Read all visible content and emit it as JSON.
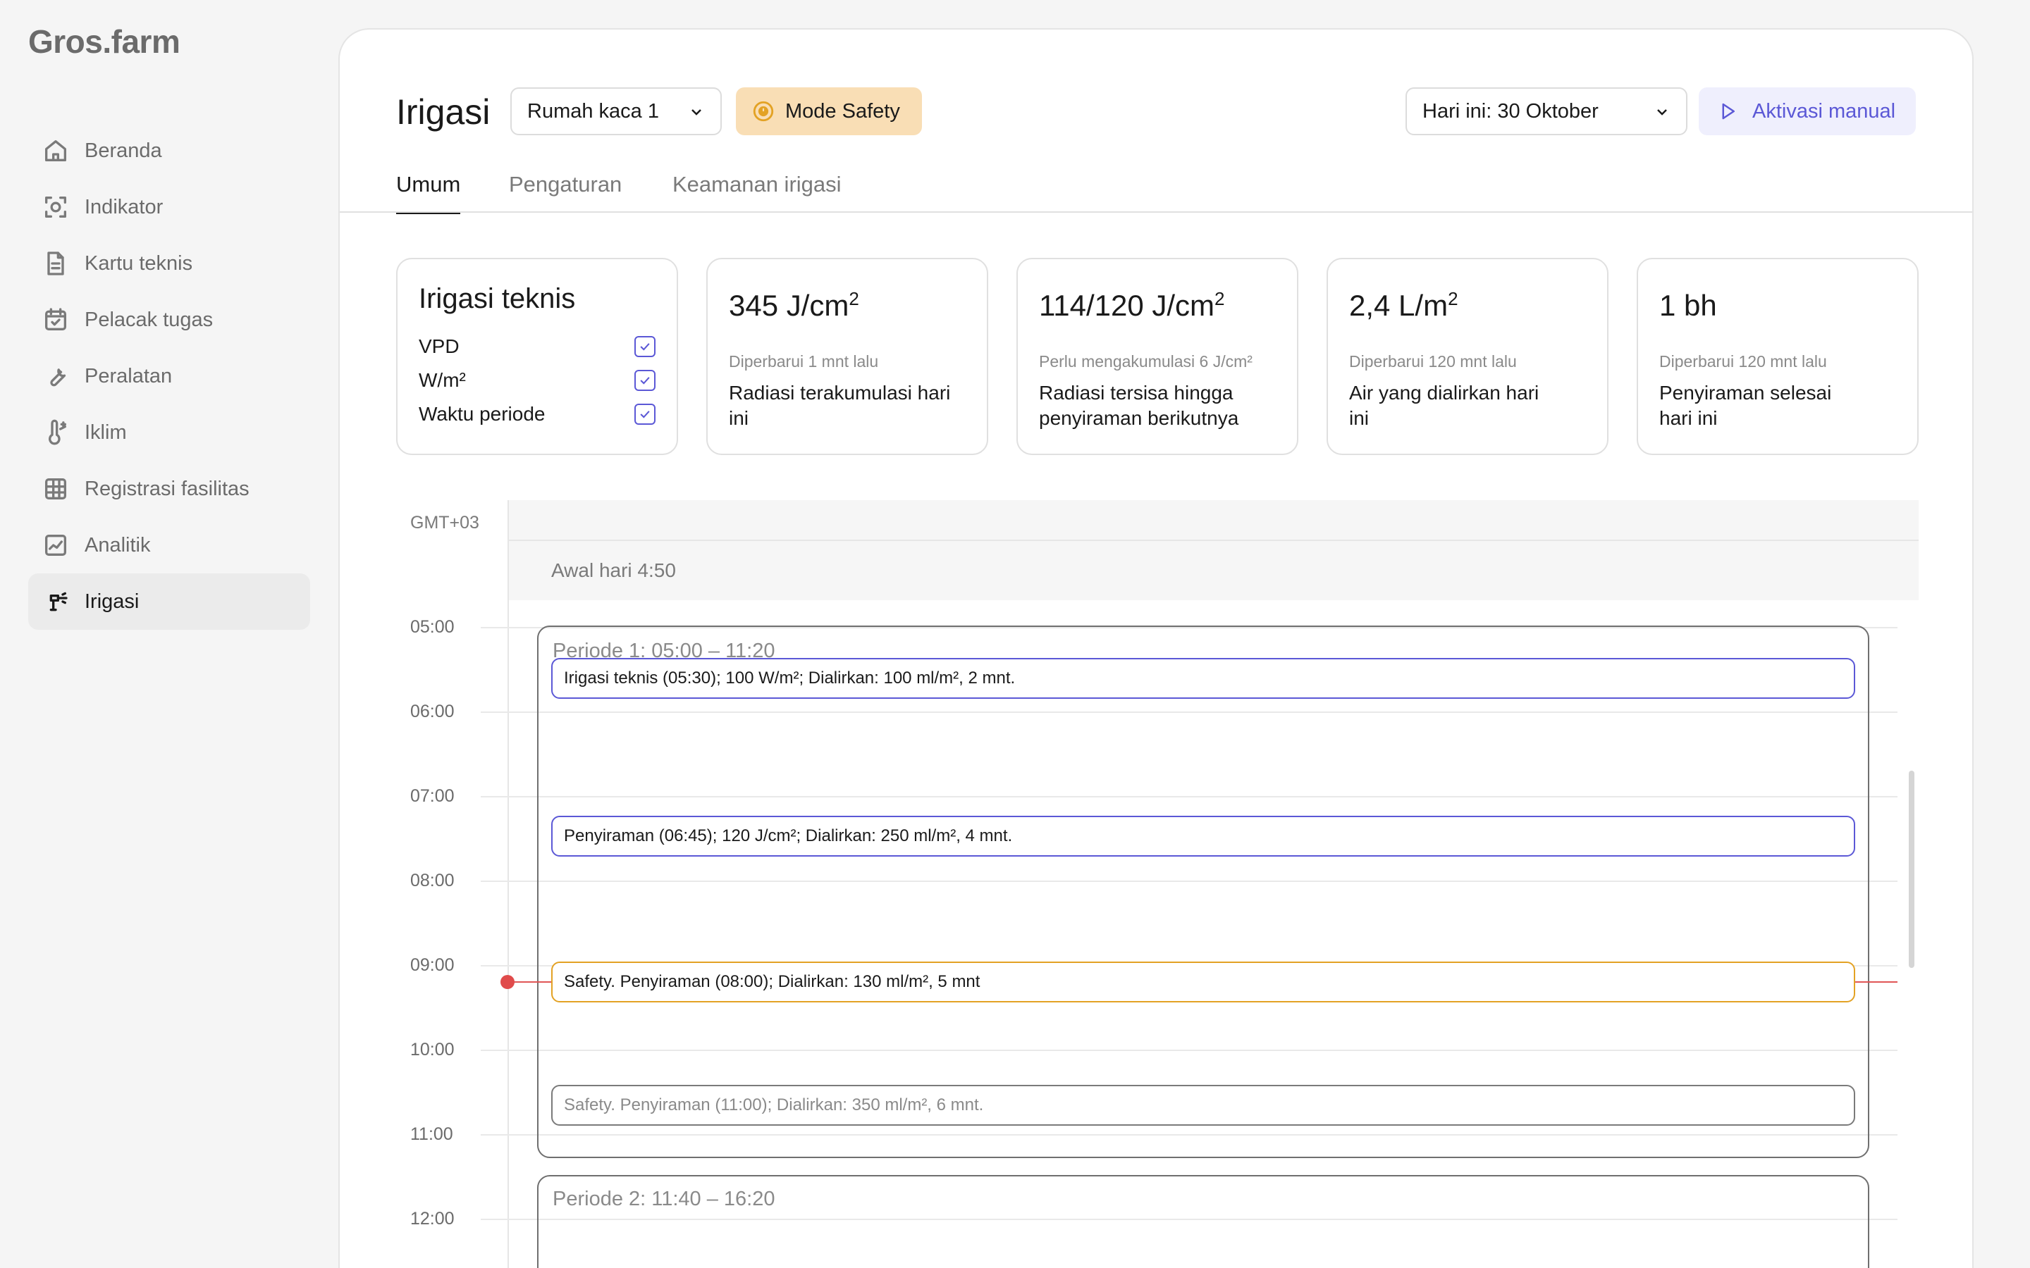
{
  "app": {
    "logo": "Gros.farm"
  },
  "sidebar": {
    "items": [
      {
        "label": "Beranda",
        "icon": "home-icon"
      },
      {
        "label": "Indikator",
        "icon": "indicator-icon"
      },
      {
        "label": "Kartu teknis",
        "icon": "document-icon"
      },
      {
        "label": "Pelacak tugas",
        "icon": "calendar-check-icon"
      },
      {
        "label": "Peralatan",
        "icon": "wrench-icon"
      },
      {
        "label": "Iklim",
        "icon": "thermometer-icon"
      },
      {
        "label": "Registrasi fasilitas",
        "icon": "grid-icon"
      },
      {
        "label": "Analitik",
        "icon": "chart-icon"
      },
      {
        "label": "Irigasi",
        "icon": "sprinkler-icon",
        "active": true
      }
    ]
  },
  "header": {
    "title": "Irigasi",
    "greenhouse": "Rumah kaca 1",
    "mode_label": "Mode Safety",
    "date_label": "Hari ini: 30 Oktober",
    "manual_label": "Aktivasi manual"
  },
  "tabs": [
    "Umum",
    "Pengaturan",
    "Keamanan irigasi"
  ],
  "cards": {
    "technical": {
      "title": "Irigasi teknis",
      "checks": [
        {
          "label": "VPD",
          "checked": true
        },
        {
          "label": "W/m²",
          "checked": true
        },
        {
          "label": "Waktu periode",
          "checked": true
        }
      ]
    },
    "stats": [
      {
        "value": "345 J/cm",
        "sup": "2",
        "meta": "Diperbarui 1 mnt lalu",
        "desc": "Radiasi terakumulasi hari ini"
      },
      {
        "value": "114/120 J/cm",
        "sup": "2",
        "meta": "Perlu mengakumulasi 6 J/cm²",
        "desc": "Radiasi tersisa hingga penyiraman berikutnya"
      },
      {
        "value": "2,4 L/m",
        "sup": "2",
        "meta": "Diperbarui 120 mnt lalu",
        "desc": "Air yang dialirkan hari ini"
      },
      {
        "value": "1 bh",
        "sup": "",
        "meta": "Diperbarui 120 mnt lalu",
        "desc": "Penyiraman selesai hari ini"
      }
    ]
  },
  "schedule": {
    "timezone": "GMT+03",
    "day_start": "Awal hari 4:50",
    "hours": [
      "05:00",
      "06:00",
      "07:00",
      "08:00",
      "09:00",
      "10:00",
      "11:00",
      "12:00"
    ],
    "periods": [
      {
        "title": "Periode 1: 05:00 – 11:20"
      },
      {
        "title": "Periode 2: 11:40 – 16:20"
      }
    ],
    "events": [
      {
        "text": "Irigasi teknis (05:30); 100 W/m²; Dialirkan: 100 ml/m², 2 mnt.",
        "kind": "normal"
      },
      {
        "text": "Penyiraman (06:45); 120 J/cm²; Dialirkan: 250 ml/m², 4 mnt.",
        "kind": "normal"
      },
      {
        "text": "Safety. Penyiraman (08:00); Dialirkan: 130 ml/m², 5 mnt",
        "kind": "warn"
      },
      {
        "text": "Safety. Penyiraman (11:00); Dialirkan: 350 ml/m², 6 mnt.",
        "kind": "muted"
      }
    ]
  },
  "colors": {
    "accent": "#5b58d6",
    "warning": "#e3a224",
    "safety_bg": "#f9deb5",
    "now": "#e04b4b"
  }
}
